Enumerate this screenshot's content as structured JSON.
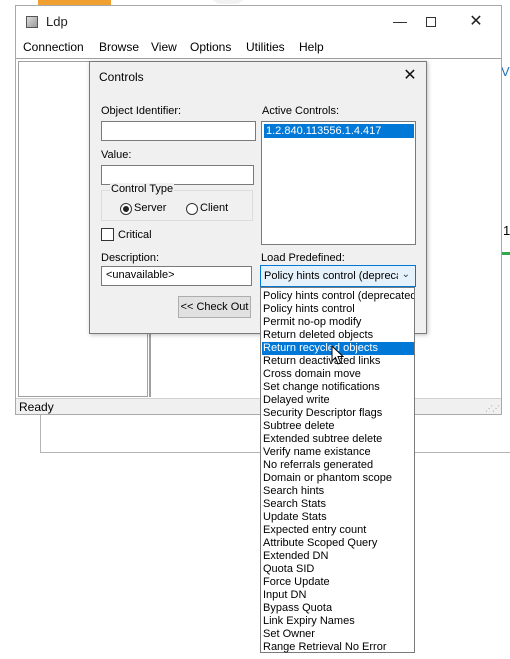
{
  "window": {
    "title": "Ldp",
    "menu": [
      "Connection",
      "Browse",
      "View",
      "Options",
      "Utilities",
      "Help"
    ],
    "status": "Ready"
  },
  "background": {
    "right_letter": "V",
    "right_digit": "1"
  },
  "dialog": {
    "title": "Controls",
    "object_identifier_label": "Object Identifier:",
    "object_identifier_value": "",
    "value_label": "Value:",
    "value_value": "",
    "control_type_label": "Control Type",
    "radio_server": "Server",
    "radio_client": "Client",
    "selected_control_type": "Server",
    "critical_label": "Critical",
    "critical_checked": false,
    "description_label": "Description:",
    "description_value": "<unavailable>",
    "check_out_button": "<< Check Out",
    "active_controls_label": "Active Controls:",
    "active_controls": [
      "1.2.840.113556.1.4.417"
    ],
    "load_predefined_label": "Load Predefined:",
    "load_predefined_value": "Policy hints control (deprecated)",
    "options": [
      "Policy hints control (deprecated)",
      "Policy hints control",
      "Permit no-op modify",
      "Return deleted objects",
      "Return recycled objects",
      "Return deactivated links",
      "Cross domain move",
      "Set change notifications",
      "Delayed write",
      "Security Descriptor flags",
      "Subtree delete",
      "Extended subtree delete",
      "Verify name existance",
      "No referrals generated",
      "Domain or phantom scope",
      "Search hints",
      "Search Stats",
      "Update Stats",
      "Expected entry count",
      "Attribute Scoped Query",
      "Extended DN",
      "Quota SID",
      "Force Update",
      "Input DN",
      "Bypass Quota",
      "Link Expiry Names",
      "Set Owner",
      "Range Retrieval No Error"
    ],
    "highlighted_option": "Return recycled objects"
  },
  "colors": {
    "selection": "#0078d7",
    "dialog_bg": "#f0f0f0",
    "accent_orange": "#f0a030",
    "accent_green": "#2fa84f"
  }
}
